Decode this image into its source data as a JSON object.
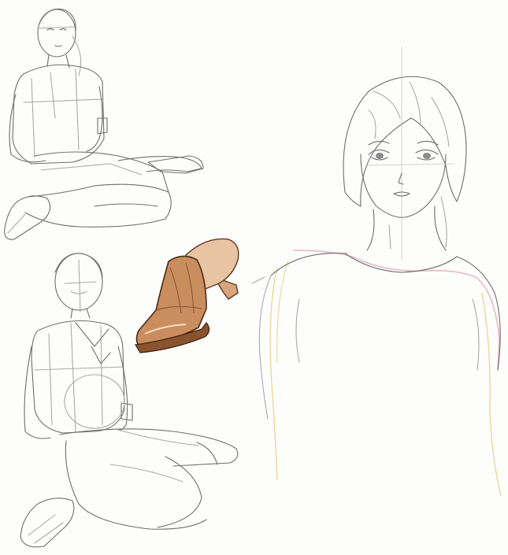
{
  "colors": {
    "paper": "#fdfdfc",
    "graphite": "#6e6e6e",
    "graphite_light": "#a9a9a9",
    "shoe_fill": "#c98d5e",
    "shoe_shadow": "#8a5330",
    "pink_pencil": "#e9b9c4",
    "yellow_pencil": "#ecd79a"
  },
  "subjects": [
    "seated-figure-crosslegged",
    "seated-figure-kneeling",
    "mule-shoe",
    "portrait-bust"
  ]
}
